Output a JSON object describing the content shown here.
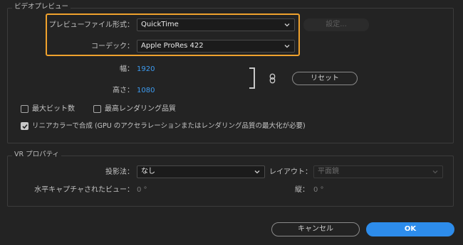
{
  "video_preview": {
    "group_title": "ビデオプレビュー",
    "file_format_label": "プレビューファイル形式：",
    "file_format_value": "QuickTime",
    "settings_button": "設定...",
    "codec_label": "コーデック：",
    "codec_value": "Apple ProRes 422",
    "width_label": "幅：",
    "width_value": "1920",
    "height_label": "高さ：",
    "height_value": "1080",
    "reset_button": "リセット",
    "max_bit_depth_label": "最大ビット数",
    "max_render_quality_label": "最高レンダリング品質",
    "linear_color_label": "リニアカラーで合成 (GPU のアクセラレーションまたはレンダリング品質の最大化が必要)",
    "checkboxes": {
      "max_bit_depth": false,
      "max_render_quality": false,
      "linear_color": true
    }
  },
  "vr_properties": {
    "group_title": "VR プロパティ",
    "projection_label": "投影法：",
    "projection_value": "なし",
    "layout_label": "レイアウト：",
    "layout_value": "平面鏡",
    "h_fov_label": "水平キャプチャされたビュー：",
    "h_fov_value": "0 °",
    "v_fov_label": "縦：",
    "v_fov_value": "0 °"
  },
  "footer": {
    "cancel_button": "キャンセル",
    "ok_button": "OK"
  },
  "colors": {
    "background": "#232323",
    "accent": "#2d8ceb",
    "link": "#3d9bf0",
    "highlight": "#f0a22d"
  },
  "icons": {
    "chevron": "chevron-down-icon",
    "link": "link-icon",
    "check": "check-icon"
  }
}
